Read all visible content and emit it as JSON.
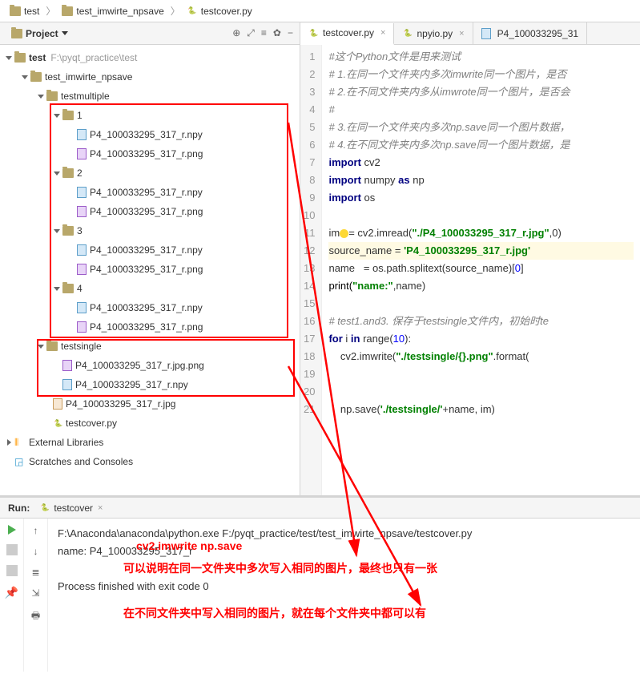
{
  "breadcrumb": {
    "items": [
      "test",
      "test_imwirte_npsave",
      "testcover.py"
    ]
  },
  "sidebar": {
    "title": "Project",
    "root_name": "test",
    "root_path": "F:\\pyqt_practice\\test",
    "folder_imw": "test_imwirte_npsave",
    "folder_multi": "testmultiple",
    "dirs": [
      "1",
      "2",
      "3",
      "4"
    ],
    "file_npy": "P4_100033295_317_r.npy",
    "file_png": "P4_100033295_317_r.png",
    "folder_single": "testsingle",
    "file_jpgpng": "P4_100033295_317_r.jpg.png",
    "file_singlenpy": "P4_100033295_317_r.npy",
    "file_rootjpg": "P4_100033295_317_r.jpg",
    "file_cover": "testcover.py",
    "ext_libs": "External Libraries",
    "scratches": "Scratches and Consoles"
  },
  "tabs": {
    "t1": "testcover.py",
    "t2": "npyio.py",
    "t3": "P4_100033295_31"
  },
  "code": {
    "l1": "#这个Python文件是用来测试",
    "l2": "# 1.在同一个文件夹内多次imwrite同一个图片，是否",
    "l3": "# 2.在不同文件夹内多从imwrote同一个图片，是否会",
    "l4": "#",
    "l5": "# 3.在同一个文件夹内多次np.save同一个图片数据，",
    "l6": "# 4.在不同文件夹内多次np.save同一个图片数据，是",
    "l11a": "im",
    "l11b": "= cv2.imread(",
    "l11c": "\"./P4_100033295_317_r.jpg\"",
    "l11d": ",0)",
    "l12a": "source_name = ",
    "l12b": "'P4_100033295_317_r.jpg'",
    "l13a": "name   = os.path.splitext(source_name)[",
    "l13b": "0",
    "l13c": "]",
    "l14a": "print(",
    "l14b": "\"name:\"",
    "l14c": ",name)",
    "l16": "# test1.and3. 保存于testsingle文件内，初始时te",
    "l17a": "for ",
    "l17b": "i ",
    "l17c": "in ",
    "l17d": "range(",
    "l17e": "10",
    "l17f": "):",
    "l18a": "    cv2.imwrite(",
    "l18b": "\"./testsingle/{}.png\"",
    "l18c": ".format(",
    "l21a": "    np.save(",
    "l21b": "'./testsingle/'",
    "l21c": "+name, im)",
    "imp_cv2": "import ",
    "imp_cv2b": "cv2",
    "imp_np": "import ",
    "imp_npb": "numpy ",
    "imp_npc": "as ",
    "imp_npd": "np",
    "imp_os": "import ",
    "imp_osb": "os"
  },
  "run": {
    "label": "Run:",
    "name": "testcover",
    "line1": "F:\\Anaconda\\anaconda\\python.exe F:/pyqt_practice/test/test_imwirte_npsave/testcover.py",
    "line2": "name: P4_100033295_317_r",
    "line3": "Process finished with exit code 0"
  },
  "ann": {
    "a1": "cv2.imwrite  np.save",
    "a2": "可以说明在同一文件夹中多次写入相同的图片，最终也只有一张",
    "a3": "在不同文件夹中写入相同的图片，就在每个文件夹中都可以有"
  },
  "gutter_lines": [
    "1",
    "2",
    "3",
    "4",
    "5",
    "6",
    "7",
    "8",
    "9",
    "10",
    "11",
    "12",
    "13",
    "14",
    "15",
    "16",
    "17",
    "18",
    "19",
    "20",
    "21"
  ]
}
